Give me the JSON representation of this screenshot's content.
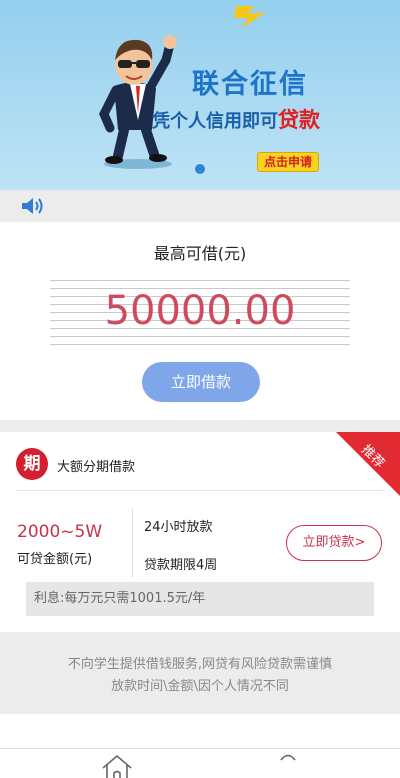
{
  "banner": {
    "title": "联合征信",
    "subtitle_prefix": "凭个人信用即可",
    "subtitle_highlight": "贷款",
    "apply_label": "点击申请"
  },
  "notice": {
    "icon": "speaker-icon"
  },
  "max_loan": {
    "title": "最高可借(元)",
    "amount": "50000.00",
    "button_label": "立即借款"
  },
  "product": {
    "ribbon": "推荐",
    "badge": "期",
    "name": "大额分期借款",
    "range": "2000~5W",
    "range_label": "可贷金额(元)",
    "feature1": "24小时放款",
    "feature2": "贷款期限4周",
    "button_label": "立即贷款>",
    "interest": "利息:每万元只需1001.5元/年"
  },
  "disclaimer": {
    "line1": "不向学生提供借钱服务,网贷有风险贷款需谨慎",
    "line2": "放款时间\\金额\\因个人情况不同"
  },
  "tabbar": {
    "icons": [
      "home-icon",
      "user-icon"
    ]
  },
  "colors": {
    "accent_red": "#c8324a",
    "button_blue": "#7ea6e8",
    "badge_red": "#d51f2e"
  }
}
